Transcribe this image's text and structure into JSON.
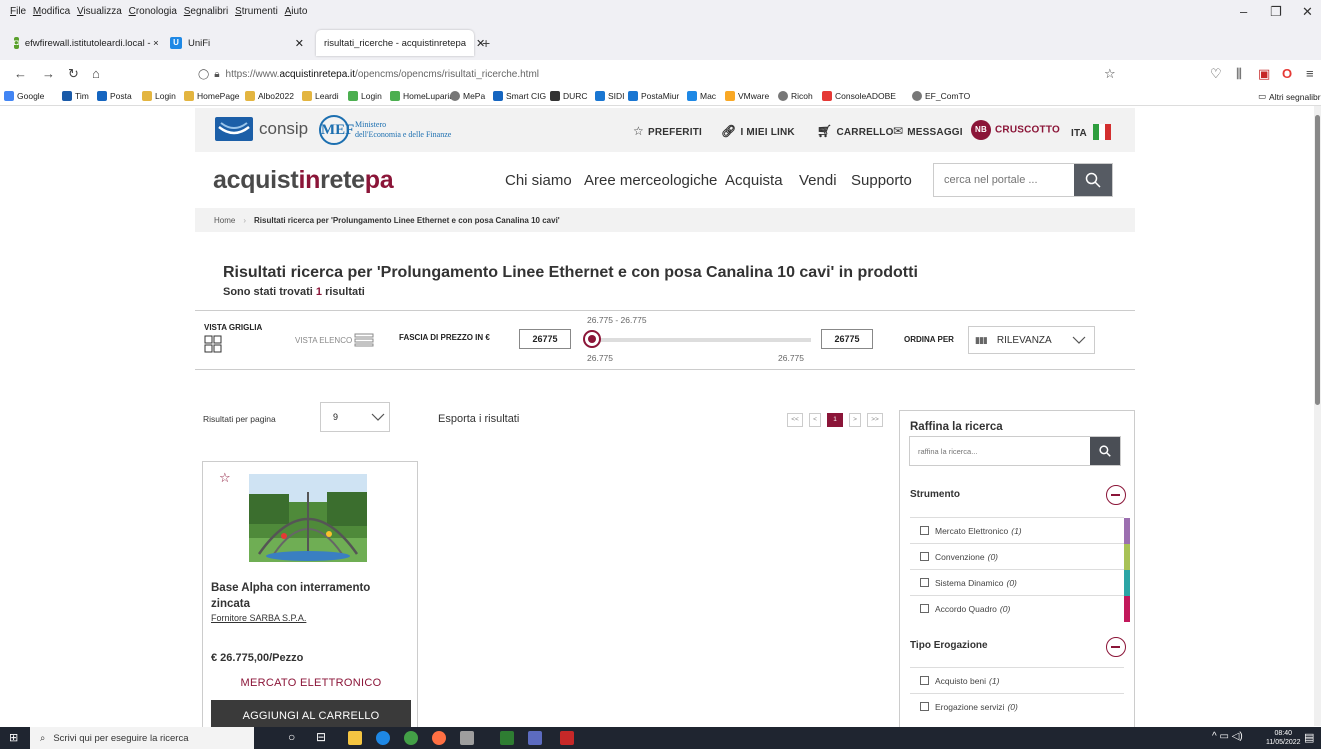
{
  "browser": {
    "menu": [
      "File",
      "Modifica",
      "Visualizza",
      "Cronologia",
      "Segnalibri",
      "Strumenti",
      "Aiuto"
    ],
    "tabs": [
      {
        "label": "efwfirewall.istitutoleardi.local - ×",
        "fav_color": "#5aa02c"
      },
      {
        "label": "UniFi",
        "fav_color": "#1e88e5"
      },
      {
        "label": "risultati_ricerche - acquistinretepa",
        "fav_color": "#ffffff"
      }
    ],
    "url_prefix": "https://www.",
    "url_domain": "acquistinretepa.it",
    "url_path": "/opencms/opencms/risultati_ricerche.html",
    "bookmarks": [
      {
        "label": "Google",
        "color": "#4285f4"
      },
      {
        "label": "Tim",
        "color": "#1a5aa8"
      },
      {
        "label": "Posta",
        "color": "#1565c0"
      },
      {
        "label": "Login",
        "color": "#e3b540"
      },
      {
        "label": "HomePage",
        "color": "#e3b540"
      },
      {
        "label": "Albo2022",
        "color": "#e3b540"
      },
      {
        "label": "Leardi",
        "color": "#e3b540"
      },
      {
        "label": "Login",
        "color": "#4caf50"
      },
      {
        "label": "HomeLuparia",
        "color": "#4caf50"
      },
      {
        "label": "MePa",
        "color": "#777777"
      },
      {
        "label": "Smart CIG",
        "color": "#1565c0"
      },
      {
        "label": "DURC",
        "color": "#333333"
      },
      {
        "label": "SIDI",
        "color": "#1976d2"
      },
      {
        "label": "PostaMiur",
        "color": "#1976d2"
      },
      {
        "label": "Mac",
        "color": "#1e88e5"
      },
      {
        "label": "VMware",
        "color": "#f9a825"
      },
      {
        "label": "Ricoh",
        "color": "#777777"
      },
      {
        "label": "ConsoleADOBE",
        "color": "#e53935"
      },
      {
        "label": "EF_ComTO",
        "color": "#777777"
      }
    ],
    "other_bookmarks": "Altri segnalibri"
  },
  "header": {
    "consip": "consip",
    "mef_logo": "MEF",
    "mef_line1": "Ministero",
    "mef_line2": "dell'Economia e delle Finanze",
    "links": {
      "preferiti": "PREFERITI",
      "miei_link": "I MIEI LINK",
      "carrello": "CARRELLO",
      "messaggi": "MESSAGGI",
      "cruscotto": "CRUSCOTTO",
      "lang": "ITA"
    },
    "user_initials": "NB"
  },
  "brand": {
    "part1": "acquist",
    "part2": "in",
    "part3": "rete",
    "part4": "pa"
  },
  "nav": [
    "Chi siamo",
    "Aree merceologiche",
    "Acquista",
    "Vendi",
    "Supporto"
  ],
  "search": {
    "placeholder": "cerca nel portale ..."
  },
  "breadcrumb": {
    "home": "Home",
    "current": "Risultati ricerca per 'Prolungamento Linee Ethernet e con posa Canalina 10 cavi'"
  },
  "results": {
    "title": "Risultati ricerca per 'Prolungamento Linee Ethernet e con posa Canalina 10 cavi' in prodotti",
    "count_prefix": "Sono stati trovati",
    "count": "1",
    "count_suffix": "risultati"
  },
  "filters": {
    "grid_view": "VISTA GRIGLIA",
    "list_view": "VISTA ELENCO",
    "price_label": "FASCIA DI PREZZO IN €",
    "price_min": "26775",
    "price_max": "26775",
    "range_label": "26.775 - 26.775",
    "range_min": "26.775",
    "range_max": "26.775",
    "sort_label": "ORDINA PER",
    "sort_value": "RILEVANZA"
  },
  "controls": {
    "per_page_label": "Risultati per pagina",
    "per_page_value": "9",
    "export": "Esporta i risultati",
    "pagination": [
      "<<",
      "<",
      "1",
      ">",
      ">>"
    ]
  },
  "product": {
    "title": "Base Alpha con interramento zincata",
    "supplier": "Fornitore SARBA S.P.A.",
    "price": "€ 26.775,00/Pezzo",
    "type": "MERCATO ELETTRONICO",
    "add_label": "AGGIUNGI AL CARRELLO"
  },
  "refine": {
    "title": "Raffina la ricerca",
    "placeholder": "raffina la ricerca...",
    "section1": {
      "title": "Strumento",
      "options": [
        {
          "label": "Mercato Elettronico",
          "count": "(1)",
          "color": "#9c6fb0"
        },
        {
          "label": "Convenzione",
          "count": "(0)",
          "color": "#a8c256"
        },
        {
          "label": "Sistema Dinamico",
          "count": "(0)",
          "color": "#2ba5a5"
        },
        {
          "label": "Accordo Quadro",
          "count": "(0)",
          "color": "#c2185b"
        }
      ]
    },
    "section2": {
      "title": "Tipo Erogazione",
      "options": [
        {
          "label": "Acquisto beni",
          "count": "(1)"
        },
        {
          "label": "Erogazione servizi",
          "count": "(0)"
        }
      ]
    }
  },
  "taskbar": {
    "search": "Scrivi qui per eseguire la ricerca",
    "time": "08:40",
    "date": "11/05/2022"
  }
}
